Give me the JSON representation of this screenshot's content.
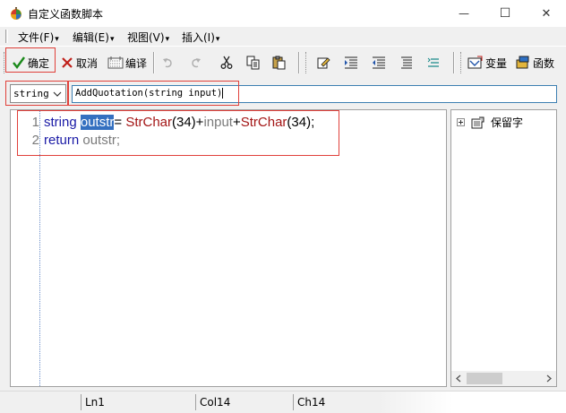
{
  "window": {
    "title": "自定义函数脚本",
    "minimize_glyph": "—",
    "maximize_glyph": "☐",
    "close_glyph": "✕"
  },
  "menu": [
    {
      "label": "文件(F)"
    },
    {
      "label": "编辑(E)"
    },
    {
      "label": "视图(V)"
    },
    {
      "label": "插入(I)"
    }
  ],
  "toolbar": {
    "ok_label": "确定",
    "cancel_label": "取消",
    "compile_label": "编译",
    "variable_label": "变量",
    "function_label": "函数"
  },
  "signature": {
    "return_type": "string",
    "text": "AddQuotation(string input)"
  },
  "editor": {
    "lines": [
      {
        "number": "1",
        "tokens": [
          "string",
          " ",
          "outstr",
          "= ",
          "StrChar",
          "(34)+",
          "input",
          "+",
          "StrChar",
          "(34);"
        ]
      },
      {
        "number": "2",
        "tokens": [
          "return",
          " ",
          "outstr",
          ";"
        ]
      }
    ]
  },
  "tree": {
    "root_label": "保留字"
  },
  "status": {
    "line": "Ln1",
    "col": "Col14",
    "ch": "Ch14"
  },
  "colors": {
    "keyword": "#1a1aa6",
    "function": "#a31515",
    "variable": "#7a7a7a",
    "selection": "#3470c0",
    "annotation_box": "#e0403a"
  }
}
